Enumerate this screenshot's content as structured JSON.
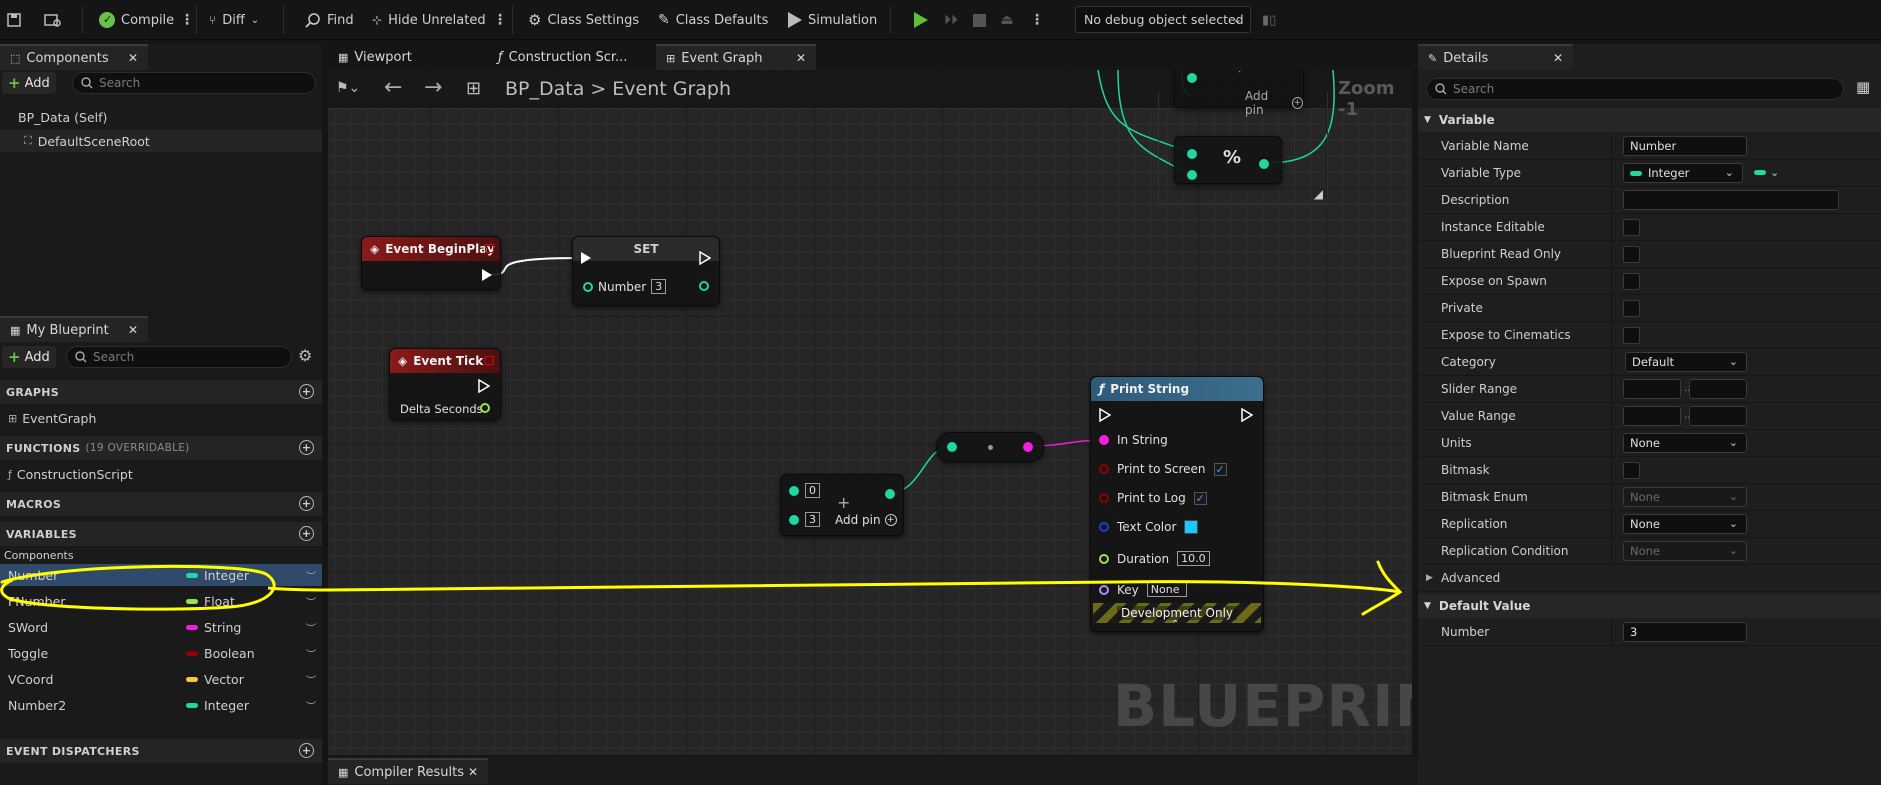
{
  "toolbar": {
    "compile": "Compile",
    "diff": "Diff",
    "find": "Find",
    "hide_unrelated": "Hide Unrelated",
    "class_settings": "Class Settings",
    "class_defaults": "Class Defaults",
    "simulation": "Simulation",
    "debug_object": "No debug object selected"
  },
  "components_panel": {
    "tab": "Components",
    "add": "Add",
    "search_placeholder": "Search",
    "items": [
      "BP_Data (Self)",
      "DefaultSceneRoot"
    ]
  },
  "my_blueprint": {
    "tab": "My Blueprint",
    "add": "Add",
    "search_placeholder": "Search",
    "sections": {
      "graphs": "GRAPHS",
      "functions": "FUNCTIONS",
      "functions_count": "(19 OVERRIDABLE)",
      "macros": "MACROS",
      "variables": "VARIABLES",
      "event_dispatchers": "EVENT DISPATCHERS"
    },
    "graph_items": [
      "EventGraph"
    ],
    "function_items": [
      "ConstructionScript"
    ],
    "variables_category": "Components",
    "variables": [
      {
        "name": "Number",
        "type": "Integer",
        "color": "#1fd6a4"
      },
      {
        "name": "FNumber",
        "type": "Float",
        "color": "#9ae24a"
      },
      {
        "name": "SWord",
        "type": "String",
        "color": "#f51ee0"
      },
      {
        "name": "Toggle",
        "type": "Boolean",
        "color": "#930000"
      },
      {
        "name": "VCoord",
        "type": "Vector",
        "color": "#f7c932"
      },
      {
        "name": "Number2",
        "type": "Integer",
        "color": "#1fd6a4"
      }
    ]
  },
  "editor_tabs": [
    "Viewport",
    "Construction Scr...",
    "Event Graph"
  ],
  "breadcrumb": {
    "root": "BP_Data",
    "separator": ">",
    "current": "Event Graph"
  },
  "zoom": "Zoom -1",
  "watermark": "BLUEPRINT",
  "graph_nodes": {
    "begin_play": "Event BeginPlay",
    "set_title": "SET",
    "set_pin": "Number",
    "set_value": "3",
    "event_tick": "Event Tick",
    "delta_seconds": "Delta Seconds",
    "add_a": "0",
    "add_b": "3",
    "add_pin": "Add pin",
    "add_pin_top": "Add pin",
    "modulo_symbol": "%",
    "print_string": {
      "title": "Print String",
      "in_string": "In String",
      "print_to_screen": "Print to Screen",
      "print_to_log": "Print to Log",
      "text_color": "Text Color",
      "duration": "Duration",
      "duration_value": "10.0",
      "key": "Key",
      "key_value": "None",
      "dev_only": "Development Only"
    }
  },
  "bottom_tab": "Compiler Results",
  "details": {
    "tab": "Details",
    "search_placeholder": "Search",
    "variable_category": "Variable",
    "rows": {
      "variable_name": "Variable Name",
      "variable_name_value": "Number",
      "variable_type": "Variable Type",
      "variable_type_value": "Integer",
      "description": "Description",
      "instance_editable": "Instance Editable",
      "blueprint_read_only": "Blueprint Read Only",
      "expose_on_spawn": "Expose on Spawn",
      "private": "Private",
      "expose_to_cinematics": "Expose to Cinematics",
      "category": "Category",
      "category_value": "Default",
      "slider_range": "Slider Range",
      "value_range": "Value Range",
      "units": "Units",
      "units_value": "None",
      "bitmask": "Bitmask",
      "bitmask_enum": "Bitmask Enum",
      "bitmask_enum_value": "None",
      "replication": "Replication",
      "replication_value": "None",
      "replication_condition": "Replication Condition",
      "replication_condition_value": "None"
    },
    "range_sep": "..",
    "advanced": "Advanced",
    "default_value_category": "Default Value",
    "default_number_label": "Number",
    "default_number_value": "3"
  },
  "colors": {
    "integer_pin": "#1fd6a4",
    "string_pin": "#f51ee0",
    "exec": "#ffffff",
    "event_header": "#8b1a1a",
    "function_header": "#3d6e8e",
    "annotation": "#ffff00",
    "text_color_swatch": "#18c8ff"
  }
}
